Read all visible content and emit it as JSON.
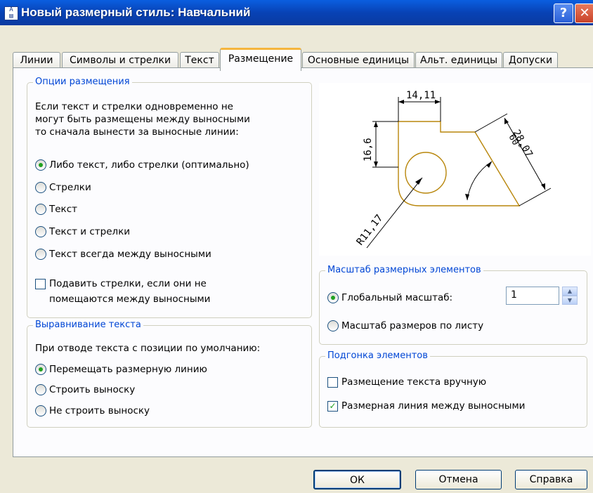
{
  "window": {
    "title": "Новый размерный стиль: Навчальний",
    "help_label": "?",
    "close_label": "✕",
    "app_icon": "dimension-style-icon"
  },
  "tabs": [
    {
      "label": "Линии",
      "active": false
    },
    {
      "label": "Символы и стрелки",
      "active": false
    },
    {
      "label": "Текст",
      "active": false
    },
    {
      "label": "Размещение",
      "active": true
    },
    {
      "label": "Основные единицы",
      "active": false
    },
    {
      "label": "Альт. единицы",
      "active": false
    },
    {
      "label": "Допуски",
      "active": false
    }
  ],
  "fit_options": {
    "title": "Опции размещения",
    "description": [
      "Если текст и стрелки одновременно не",
      "могут быть размещены между выносными",
      "то сначала вынести за выносные линии:"
    ],
    "options": [
      {
        "label": "Либо текст, либо стрелки (оптимально)",
        "checked": true
      },
      {
        "label": "Стрелки",
        "checked": false
      },
      {
        "label": "Текст",
        "checked": false
      },
      {
        "label": "Текст и стрелки",
        "checked": false
      },
      {
        "label": "Текст всегда между выносными",
        "checked": false
      }
    ],
    "suppress_label_line1": "Подавить стрелки, если они не",
    "suppress_label_line2": "помещаются между выносными",
    "suppress_checked": false
  },
  "text_placement": {
    "title": "Выравнивание текста",
    "description": "При отводе текста с позиции по умолчанию:",
    "options": [
      {
        "label": "Перемещать размерную линию",
        "checked": true
      },
      {
        "label": "Строить выноску",
        "checked": false
      },
      {
        "label": "Не строить выноску",
        "checked": false
      }
    ]
  },
  "preview": {
    "dim_top": "14,11",
    "dim_left": "16,6",
    "dim_right": "28,07",
    "dim_angle": "60°",
    "dim_radius": "R11,17"
  },
  "scale": {
    "title": "Масштаб размерных элементов",
    "global_label": "Глобальный масштаб:",
    "global_checked": true,
    "global_value": "1",
    "layout_label": "Масштаб размеров по листу",
    "layout_checked": false
  },
  "fine_tuning": {
    "title": "Подгонка элементов",
    "manual_label": "Размещение текста вручную",
    "manual_checked": false,
    "draw_line_label": "Размерная линия между выносными",
    "draw_line_checked": true
  },
  "buttons": {
    "ok": "ОК",
    "cancel": "Отмена",
    "help": "Справка"
  },
  "colors": {
    "title_bar": "#0a4fd0",
    "group_label": "#0046d5",
    "preview_geometry": "#b8860b",
    "active_tab_accent": "#f5b53d"
  }
}
